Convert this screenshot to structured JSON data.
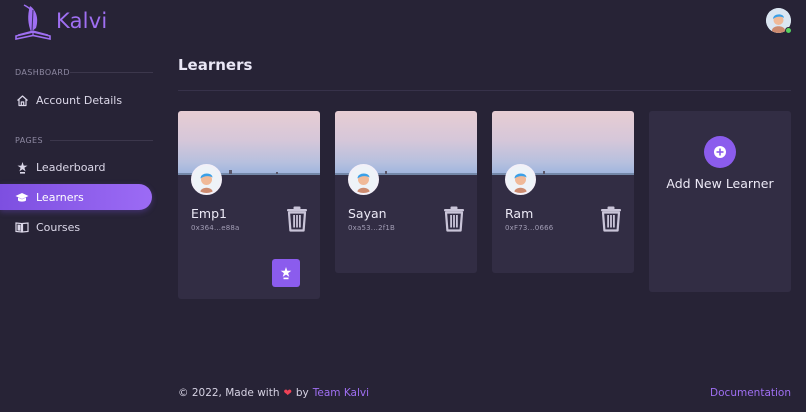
{
  "app": {
    "name": "Kalvi",
    "accent": "#9f6ff2"
  },
  "sidebar": {
    "sections": [
      {
        "label": "DASHBOARD"
      },
      {
        "label": "PAGES"
      }
    ],
    "items": [
      {
        "label": "Account Details",
        "icon": "home-icon",
        "active": false
      },
      {
        "label": "Leaderboard",
        "icon": "trophy-icon",
        "active": false
      },
      {
        "label": "Learners",
        "icon": "graduation-cap-icon",
        "active": true
      },
      {
        "label": "Courses",
        "icon": "book-icon",
        "active": false
      }
    ]
  },
  "main": {
    "title": "Learners",
    "learners": [
      {
        "name": "Emp1",
        "address": "0x364...e88a",
        "has_award_button": true
      },
      {
        "name": "Sayan",
        "address": "0xa53...2f1B",
        "has_award_button": false
      },
      {
        "name": "Ram",
        "address": "0xF73...0666",
        "has_award_button": false
      }
    ],
    "add_card": {
      "label": "Add New Learner"
    }
  },
  "footer": {
    "prefix": "© 2022, Made with",
    "by": "by",
    "team_link": "Team Kalvi",
    "docs_link": "Documentation"
  },
  "colors": {
    "background": "#272336",
    "card": "#322d44",
    "accent": "#8b5ced",
    "heart": "#ef4257",
    "online": "#57d25f"
  }
}
